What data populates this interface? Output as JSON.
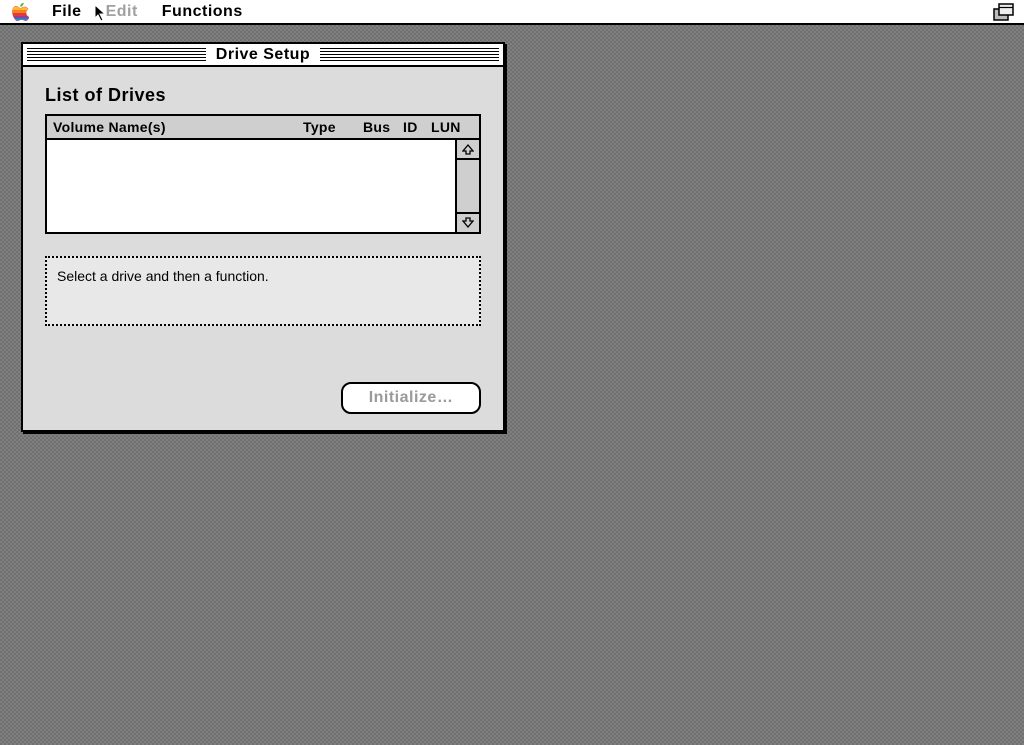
{
  "menubar": {
    "items": [
      {
        "label": "File",
        "disabled": false
      },
      {
        "label": "Edit",
        "disabled": true
      },
      {
        "label": "Functions",
        "disabled": false
      }
    ]
  },
  "window": {
    "title": "Drive Setup",
    "list": {
      "title": "List of Drives",
      "columns": {
        "volume": "Volume Name(s)",
        "type": "Type",
        "bus": "Bus",
        "id": "ID",
        "lun": "LUN"
      },
      "rows": []
    },
    "status": "Select a drive and then a function.",
    "buttons": {
      "initialize": "Initialize…"
    }
  },
  "icons": {
    "apple": "apple-logo",
    "menubar_right": "app-switcher-icon",
    "scroll_up": "scroll-up-arrow",
    "scroll_down": "scroll-down-arrow"
  }
}
